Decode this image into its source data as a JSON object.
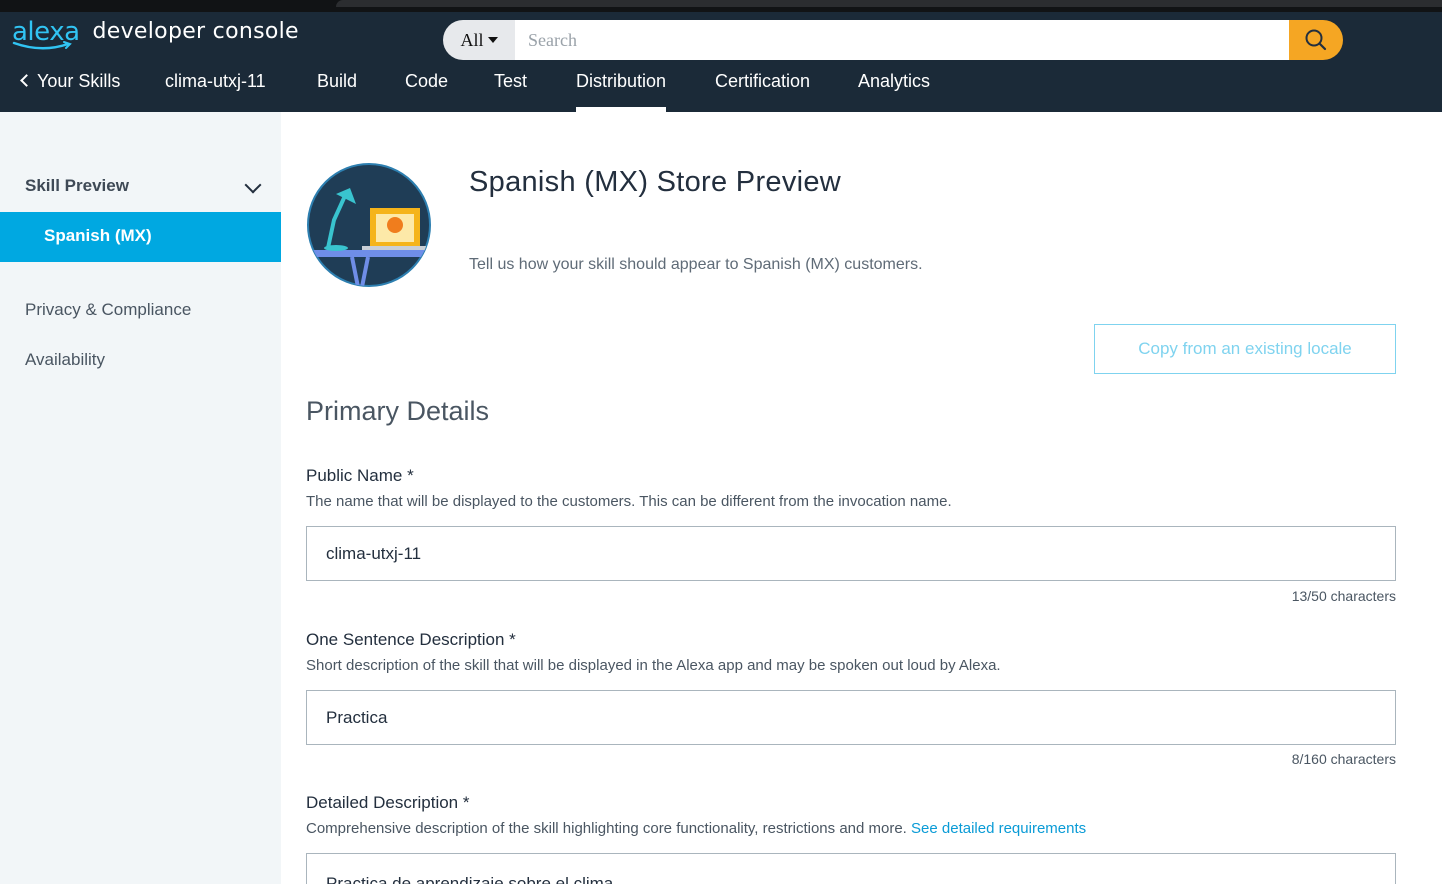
{
  "header": {
    "brand_alexa": "alexa",
    "brand_console": "developer console",
    "search": {
      "scope": "All",
      "placeholder": "Search",
      "value": ""
    }
  },
  "nav": {
    "back": "Your Skills",
    "skill_name": "clima-utxj-11",
    "tabs": [
      "Build",
      "Code",
      "Test",
      "Distribution",
      "Certification",
      "Analytics"
    ],
    "active_tab": "Distribution"
  },
  "sidebar": {
    "section": "Skill Preview",
    "active_item": "Spanish (MX)",
    "items": [
      "Privacy & Compliance",
      "Availability"
    ]
  },
  "main": {
    "title": "Spanish (MX) Store Preview",
    "subtitle": "Tell us how your skill should appear to Spanish (MX) customers.",
    "copy_button": "Copy from an existing locale",
    "section_title": "Primary Details",
    "fields": [
      {
        "label": "Public Name *",
        "help": "The name that will be displayed to the customers. This can be different from the invocation name.",
        "value": "clima-utxj-11",
        "counter": "13/50 characters"
      },
      {
        "label": "One Sentence Description *",
        "help": "Short description of the skill that will be displayed in the Alexa app and may be spoken out loud by Alexa.",
        "value": "Practica",
        "counter": "8/160 characters"
      },
      {
        "label": "Detailed Description *",
        "help": "Comprehensive description of the skill highlighting core functionality, restrictions and more.",
        "help_link": "See detailed requirements",
        "value": "Practica de aprendizaje sobre el clima"
      }
    ]
  },
  "colors": {
    "header_bg": "#1b2a38",
    "accent": "#00a8e1",
    "search_button": "#f5a623",
    "sidebar_bg": "#f2f6f8"
  }
}
